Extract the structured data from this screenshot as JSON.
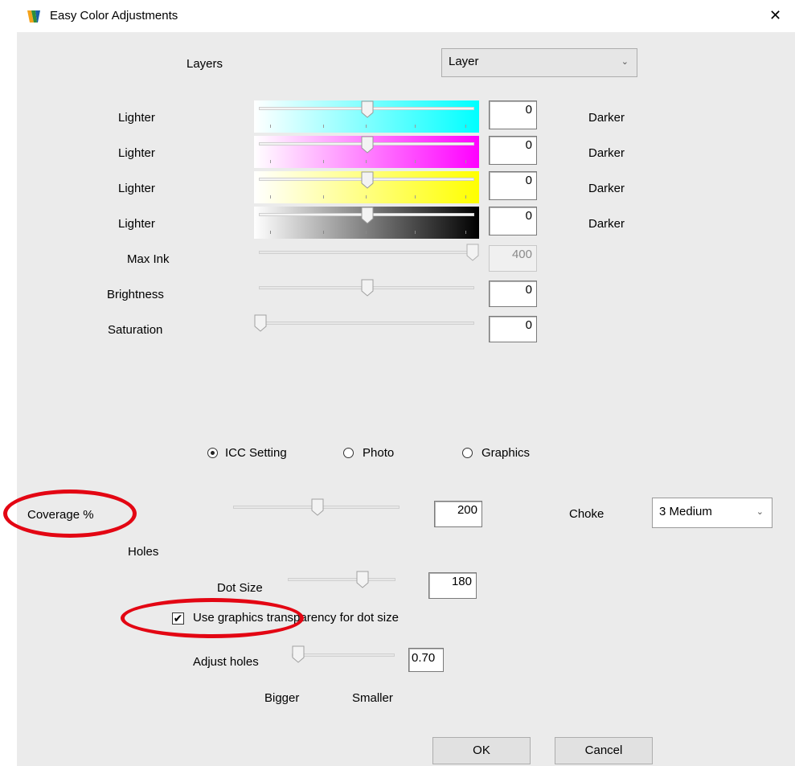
{
  "window": {
    "title": "Easy Color Adjustments",
    "close_label": "✕"
  },
  "layers": {
    "label": "Layers",
    "selected": "Layer"
  },
  "cmyk_rows": [
    {
      "left": "Lighter",
      "right": "Darker",
      "value": "0",
      "color": "#00ffff"
    },
    {
      "left": "Lighter",
      "right": "Darker",
      "value": "0",
      "color": "#ff00ff"
    },
    {
      "left": "Lighter",
      "right": "Darker",
      "value": "0",
      "color": "#ffff00"
    },
    {
      "left": "Lighter",
      "right": "Darker",
      "value": "0",
      "color": "#000000"
    }
  ],
  "max_ink": {
    "label": "Max Ink",
    "value": "400"
  },
  "brightness": {
    "label": "Brightness",
    "value": "0"
  },
  "saturation": {
    "label": "Saturation",
    "value": "0"
  },
  "render_modes": {
    "icc": "ICC Setting",
    "photo": "Photo",
    "graphics": "Graphics",
    "selected": "ICC Setting"
  },
  "coverage": {
    "label": "Coverage %",
    "value": "200"
  },
  "choke": {
    "label": "Choke",
    "selected": "3 Medium"
  },
  "holes": {
    "label": "Holes"
  },
  "dot_size": {
    "label": "Dot Size",
    "value": "180"
  },
  "use_graphics_transparency": {
    "label": "Use graphics transparency for dot size",
    "checked": true
  },
  "adjust_holes": {
    "label": "Adjust holes",
    "value": "0.70",
    "bigger": "Bigger",
    "smaller": "Smaller"
  },
  "buttons": {
    "ok": "OK",
    "cancel": "Cancel"
  }
}
